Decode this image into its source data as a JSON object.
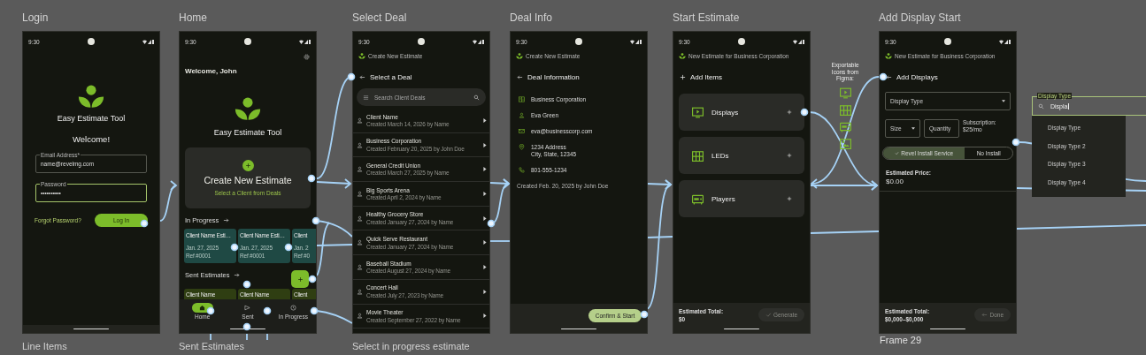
{
  "frames": [
    {
      "kind": "login",
      "label": "Login",
      "time": "9:30",
      "app_name": "Easy Estimate Tool",
      "welcome": "Welcome!",
      "email": {
        "label": "Email Address*",
        "value": "name@revelmg.com",
        "focused": false
      },
      "password": {
        "label": "Password",
        "value": "••••••••••",
        "focused": true
      },
      "forgot_link": "Forgot Password?",
      "login_button": "Log In"
    },
    {
      "kind": "home",
      "label": "Home",
      "time": "9:30",
      "greeting": "Welcome, John",
      "app_name": "Easy Estimate Tool",
      "create": {
        "title": "Create New Estimate",
        "subtitle": "Select a Client from Deals"
      },
      "in_progress": {
        "title": "In Progress",
        "cards": [
          {
            "name": "Client Name Esti…",
            "date": "Jan. 27, 2025",
            "ref": "Ref #0001"
          },
          {
            "name": "Client Name Esti…",
            "date": "Jan. 27, 2025",
            "ref": "Ref #0001"
          },
          {
            "name": "Client",
            "date": "Jan. 2",
            "ref": "Ref #0"
          }
        ]
      },
      "sent": {
        "title": "Sent Estimates",
        "cards": [
          {
            "name": "Client Name"
          },
          {
            "name": "Client Name"
          },
          {
            "name": "Client"
          }
        ]
      },
      "nav": [
        {
          "kind": "home",
          "label": "Home",
          "selected": true
        },
        {
          "kind": "sent",
          "label": "Sent",
          "selected": false
        },
        {
          "kind": "in_progress",
          "label": "In Progress",
          "selected": false
        }
      ]
    },
    {
      "kind": "deal_list",
      "label": "Select Deal",
      "time": "9:30",
      "header": "Create New Estimate",
      "title": "Select a Deal",
      "search": {
        "placeholder": "Search Client Deals"
      },
      "deals": [
        {
          "name": "Client Name",
          "meta": "Created March 14, 2026 by Name"
        },
        {
          "name": "Business Corporation",
          "meta": "Created February 20, 2025 by John Doe"
        },
        {
          "name": "General Credit Union",
          "meta": "Created March 27, 2025 by Name"
        },
        {
          "name": "Big Sports Arena",
          "meta": "Created April 2, 2024 by Name"
        },
        {
          "name": "Healthy Grocery Store",
          "meta": "Created January 27, 2024 by Name"
        },
        {
          "name": "Quick Serve Restaurant",
          "meta": "Created January 27, 2024 by Name"
        },
        {
          "name": "Baseball Stadium",
          "meta": "Created August 27, 2024 by Name"
        },
        {
          "name": "Concert Hall",
          "meta": "Created July 27, 2023 by Name"
        },
        {
          "name": "Movie Theater",
          "meta": "Created September 27, 2022 by Name"
        }
      ]
    },
    {
      "kind": "deal_info",
      "label": "Deal Info",
      "time": "9:30",
      "header": "Create New Estimate",
      "title": "Deal Information",
      "fields": [
        {
          "kind": "company",
          "lines": [
            "Business Corporation"
          ]
        },
        {
          "kind": "person",
          "lines": [
            "Eva Green"
          ]
        },
        {
          "kind": "email",
          "lines": [
            "eva@businesscorp.com"
          ]
        },
        {
          "kind": "location",
          "lines": [
            "1234 Address",
            "City, State, 12345"
          ]
        },
        {
          "kind": "phone",
          "lines": [
            "801-555-1234"
          ]
        }
      ],
      "created": "Created Feb. 20, 2025 by John Doe",
      "confirm_button": "Confirm & Start"
    },
    {
      "kind": "start_estimate",
      "label": "Start Estimate",
      "time": "9:30",
      "header": "New Estimate for Business Corporation",
      "title": "Add Items",
      "items": [
        {
          "kind": "display",
          "label": "Displays"
        },
        {
          "kind": "led",
          "label": "LEDs"
        },
        {
          "kind": "player",
          "label": "Players"
        }
      ],
      "total_label": "Estimated Total:",
      "total": "$0",
      "generate_button": {
        "label": "Generate",
        "disabled": true
      }
    },
    {
      "kind": "add_display",
      "label": "Add Display Start",
      "time": "9:30",
      "header": "New Estimate for Business Corporation",
      "title": "Add Displays",
      "display_type": {
        "placeholder": "Display Type"
      },
      "size": {
        "placeholder": "Size"
      },
      "quantity": {
        "placeholder": "Quantity"
      },
      "subscription_label": "Subscription:",
      "subscription_price": "$25/mo",
      "install_options": [
        {
          "label": "Revel Install Service",
          "selected": true
        },
        {
          "label": "No Install",
          "selected": false
        }
      ],
      "price_label": "Estimated Price:",
      "price": "$0.00",
      "total_label": "Estimated Total:",
      "total": "$0,000–$0,000",
      "done_button": {
        "label": "Done",
        "disabled": true
      },
      "caption": "Frame 29"
    }
  ],
  "exportable_icons": {
    "title": "Exportable Icons from Figma:"
  },
  "dropdown": {
    "label": "Display Type",
    "value": "Displa",
    "options": [
      "Display Type",
      "Display Type 2",
      "Display Type 3",
      "Display Type 4"
    ]
  },
  "lower_labels": [
    "Line Items",
    "Sent Estimates",
    "Select in progress estimate"
  ]
}
